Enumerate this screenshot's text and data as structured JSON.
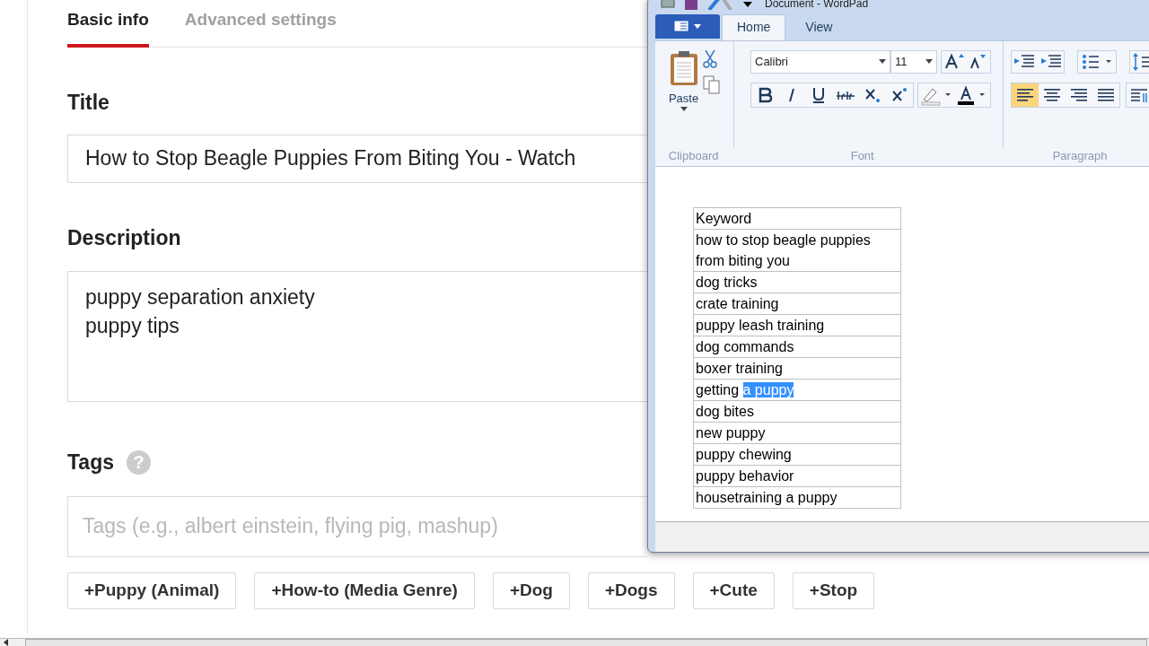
{
  "page": {
    "tabs": [
      {
        "label": "Basic info",
        "selected": true
      },
      {
        "label": "Advanced settings",
        "selected": false
      }
    ],
    "title_label": "Title",
    "title_value": "How to Stop Beagle Puppies From Biting You - Watch",
    "description_label": "Description",
    "description_value": "puppy separation anxiety\npuppy tips",
    "tags_label": "Tags",
    "help_icon": "?",
    "tags_placeholder": "Tags (e.g., albert einstein, flying pig, mashup)",
    "suggested_tags": [
      "+Puppy (Animal)",
      "+How-to (Media Genre)",
      "+Dog",
      "+Dogs",
      "+Cute",
      "+Stop"
    ]
  },
  "wordpad": {
    "window_title": "Document - WordPad",
    "ribbon_tabs": [
      {
        "label": "Home",
        "selected": true
      },
      {
        "label": "View",
        "selected": false
      }
    ],
    "paste_label": "Paste",
    "font_name": "Calibri",
    "font_size": "11",
    "groups": [
      "Clipboard",
      "Font",
      "Paragraph"
    ],
    "alignment": [
      {
        "kind": "left",
        "selected": true
      },
      {
        "kind": "center",
        "selected": false
      },
      {
        "kind": "right",
        "selected": false
      },
      {
        "kind": "justify",
        "selected": false
      }
    ],
    "table_rows": [
      {
        "text": "Keyword"
      },
      {
        "text": "how to stop beagle puppies from biting you"
      },
      {
        "text": "dog tricks"
      },
      {
        "text": "crate training"
      },
      {
        "text": "puppy leash training"
      },
      {
        "text": "dog commands"
      },
      {
        "text": "boxer training"
      },
      {
        "text": "getting",
        "highlighted_text": "a puppy"
      },
      {
        "text": "dog bites"
      },
      {
        "text": "new puppy"
      },
      {
        "text": "puppy chewing"
      },
      {
        "text": "puppy behavior"
      },
      {
        "text": "housetraining a puppy"
      }
    ]
  }
}
